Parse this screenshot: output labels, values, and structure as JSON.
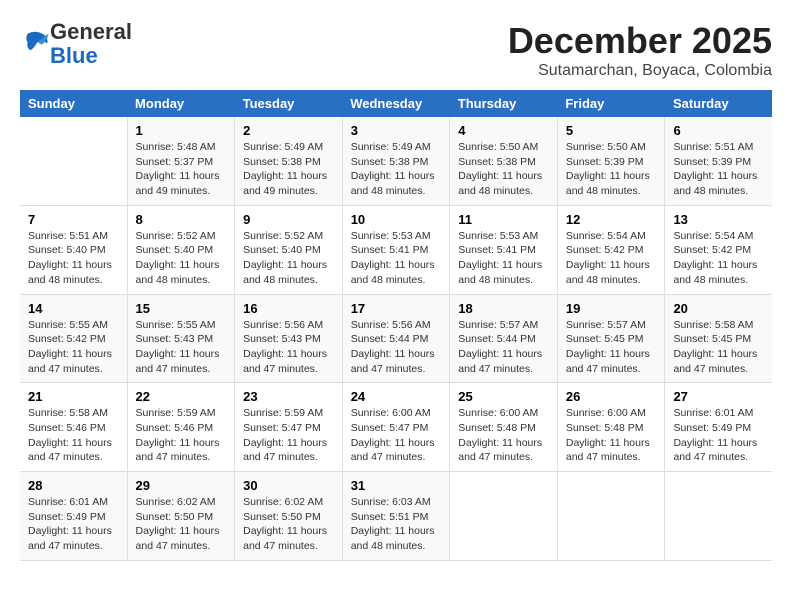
{
  "logo": {
    "general": "General",
    "blue": "Blue"
  },
  "title": "December 2025",
  "subtitle": "Sutamarchan, Boyaca, Colombia",
  "days_of_week": [
    "Sunday",
    "Monday",
    "Tuesday",
    "Wednesday",
    "Thursday",
    "Friday",
    "Saturday"
  ],
  "weeks": [
    [
      {
        "day": "",
        "info": ""
      },
      {
        "day": "1",
        "info": "Sunrise: 5:48 AM\nSunset: 5:37 PM\nDaylight: 11 hours\nand 49 minutes."
      },
      {
        "day": "2",
        "info": "Sunrise: 5:49 AM\nSunset: 5:38 PM\nDaylight: 11 hours\nand 49 minutes."
      },
      {
        "day": "3",
        "info": "Sunrise: 5:49 AM\nSunset: 5:38 PM\nDaylight: 11 hours\nand 48 minutes."
      },
      {
        "day": "4",
        "info": "Sunrise: 5:50 AM\nSunset: 5:38 PM\nDaylight: 11 hours\nand 48 minutes."
      },
      {
        "day": "5",
        "info": "Sunrise: 5:50 AM\nSunset: 5:39 PM\nDaylight: 11 hours\nand 48 minutes."
      },
      {
        "day": "6",
        "info": "Sunrise: 5:51 AM\nSunset: 5:39 PM\nDaylight: 11 hours\nand 48 minutes."
      }
    ],
    [
      {
        "day": "7",
        "info": "Sunrise: 5:51 AM\nSunset: 5:40 PM\nDaylight: 11 hours\nand 48 minutes."
      },
      {
        "day": "8",
        "info": "Sunrise: 5:52 AM\nSunset: 5:40 PM\nDaylight: 11 hours\nand 48 minutes."
      },
      {
        "day": "9",
        "info": "Sunrise: 5:52 AM\nSunset: 5:40 PM\nDaylight: 11 hours\nand 48 minutes."
      },
      {
        "day": "10",
        "info": "Sunrise: 5:53 AM\nSunset: 5:41 PM\nDaylight: 11 hours\nand 48 minutes."
      },
      {
        "day": "11",
        "info": "Sunrise: 5:53 AM\nSunset: 5:41 PM\nDaylight: 11 hours\nand 48 minutes."
      },
      {
        "day": "12",
        "info": "Sunrise: 5:54 AM\nSunset: 5:42 PM\nDaylight: 11 hours\nand 48 minutes."
      },
      {
        "day": "13",
        "info": "Sunrise: 5:54 AM\nSunset: 5:42 PM\nDaylight: 11 hours\nand 48 minutes."
      }
    ],
    [
      {
        "day": "14",
        "info": "Sunrise: 5:55 AM\nSunset: 5:42 PM\nDaylight: 11 hours\nand 47 minutes."
      },
      {
        "day": "15",
        "info": "Sunrise: 5:55 AM\nSunset: 5:43 PM\nDaylight: 11 hours\nand 47 minutes."
      },
      {
        "day": "16",
        "info": "Sunrise: 5:56 AM\nSunset: 5:43 PM\nDaylight: 11 hours\nand 47 minutes."
      },
      {
        "day": "17",
        "info": "Sunrise: 5:56 AM\nSunset: 5:44 PM\nDaylight: 11 hours\nand 47 minutes."
      },
      {
        "day": "18",
        "info": "Sunrise: 5:57 AM\nSunset: 5:44 PM\nDaylight: 11 hours\nand 47 minutes."
      },
      {
        "day": "19",
        "info": "Sunrise: 5:57 AM\nSunset: 5:45 PM\nDaylight: 11 hours\nand 47 minutes."
      },
      {
        "day": "20",
        "info": "Sunrise: 5:58 AM\nSunset: 5:45 PM\nDaylight: 11 hours\nand 47 minutes."
      }
    ],
    [
      {
        "day": "21",
        "info": "Sunrise: 5:58 AM\nSunset: 5:46 PM\nDaylight: 11 hours\nand 47 minutes."
      },
      {
        "day": "22",
        "info": "Sunrise: 5:59 AM\nSunset: 5:46 PM\nDaylight: 11 hours\nand 47 minutes."
      },
      {
        "day": "23",
        "info": "Sunrise: 5:59 AM\nSunset: 5:47 PM\nDaylight: 11 hours\nand 47 minutes."
      },
      {
        "day": "24",
        "info": "Sunrise: 6:00 AM\nSunset: 5:47 PM\nDaylight: 11 hours\nand 47 minutes."
      },
      {
        "day": "25",
        "info": "Sunrise: 6:00 AM\nSunset: 5:48 PM\nDaylight: 11 hours\nand 47 minutes."
      },
      {
        "day": "26",
        "info": "Sunrise: 6:00 AM\nSunset: 5:48 PM\nDaylight: 11 hours\nand 47 minutes."
      },
      {
        "day": "27",
        "info": "Sunrise: 6:01 AM\nSunset: 5:49 PM\nDaylight: 11 hours\nand 47 minutes."
      }
    ],
    [
      {
        "day": "28",
        "info": "Sunrise: 6:01 AM\nSunset: 5:49 PM\nDaylight: 11 hours\nand 47 minutes."
      },
      {
        "day": "29",
        "info": "Sunrise: 6:02 AM\nSunset: 5:50 PM\nDaylight: 11 hours\nand 47 minutes."
      },
      {
        "day": "30",
        "info": "Sunrise: 6:02 AM\nSunset: 5:50 PM\nDaylight: 11 hours\nand 47 minutes."
      },
      {
        "day": "31",
        "info": "Sunrise: 6:03 AM\nSunset: 5:51 PM\nDaylight: 11 hours\nand 48 minutes."
      },
      {
        "day": "",
        "info": ""
      },
      {
        "day": "",
        "info": ""
      },
      {
        "day": "",
        "info": ""
      }
    ]
  ]
}
